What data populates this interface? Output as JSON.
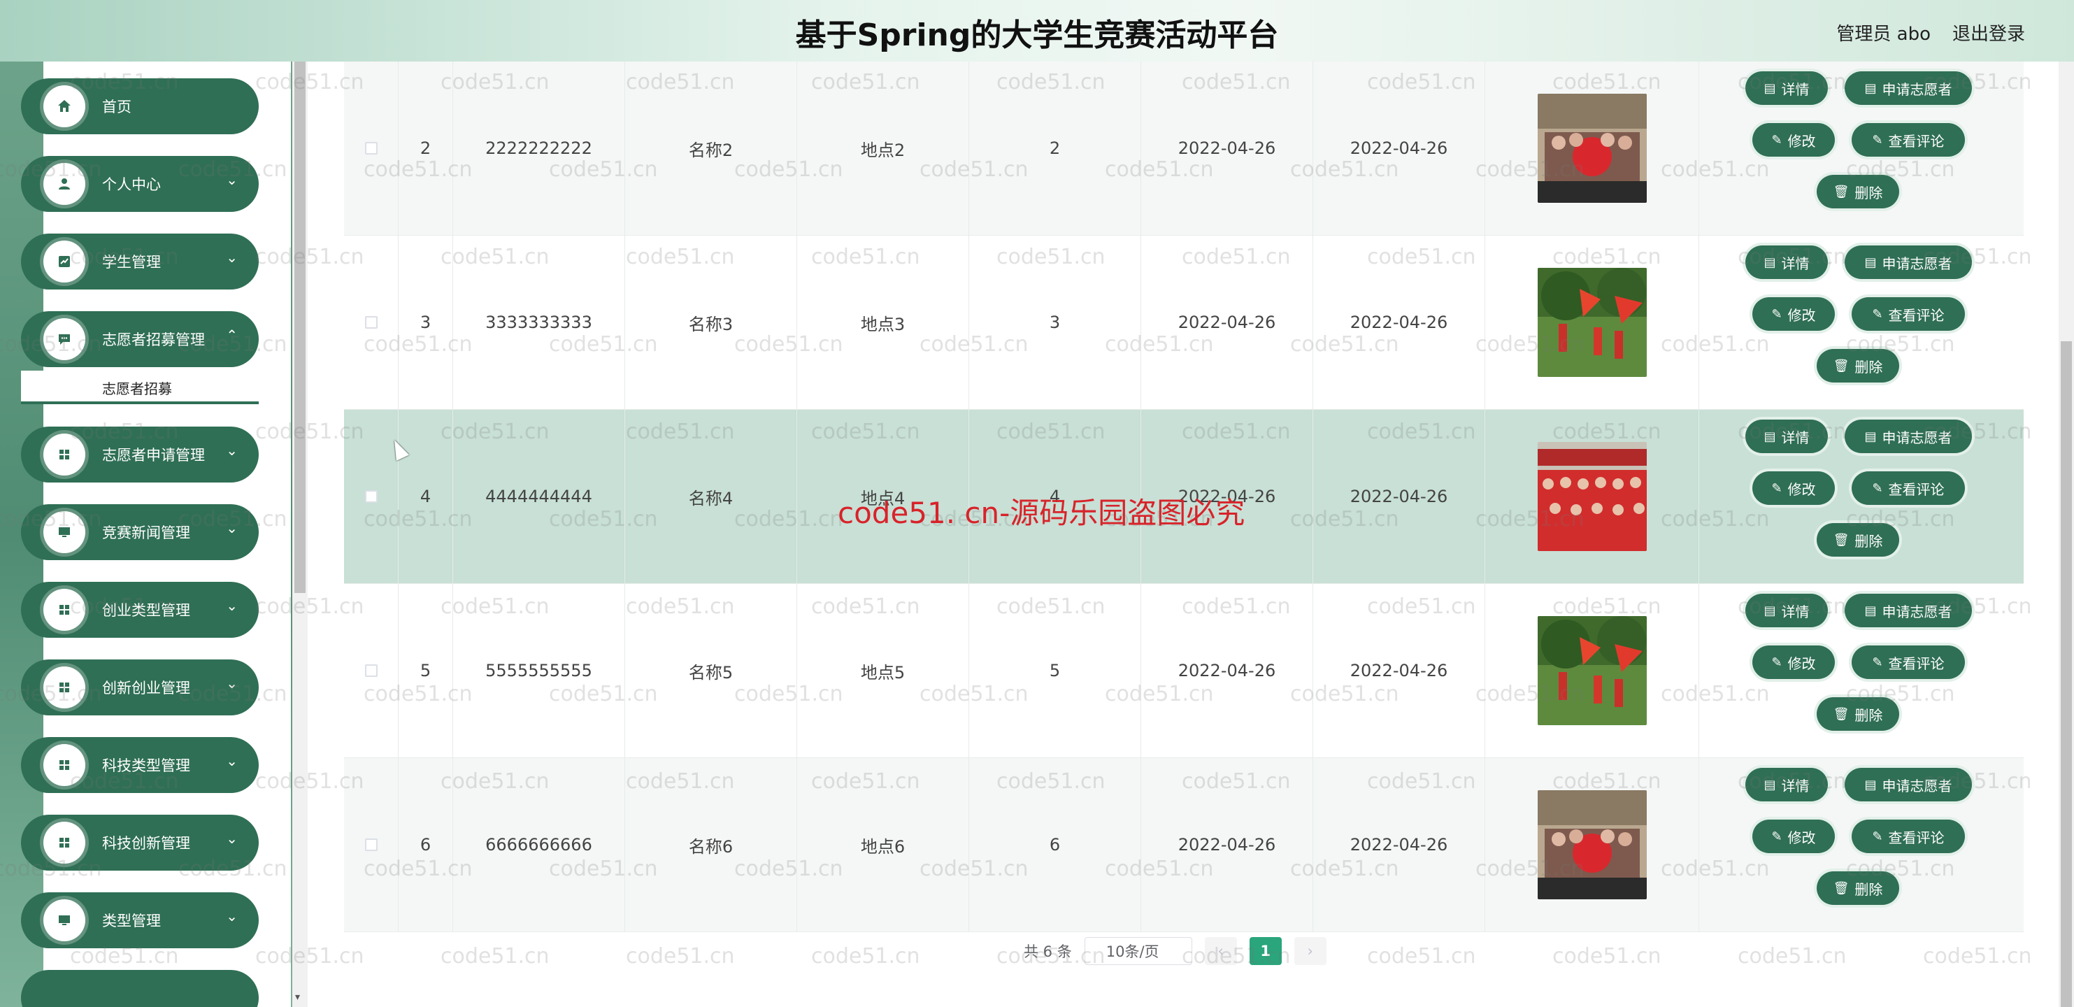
{
  "header": {
    "title": "基于Spring的大学生竞赛活动平台",
    "admin_label": "管理员 abo",
    "logout_label": "退出登录"
  },
  "sidebar": {
    "items": [
      {
        "label": "首页",
        "icon": "home-icon",
        "chevron": ""
      },
      {
        "label": "个人中心",
        "icon": "user-icon",
        "chevron": "⌄"
      },
      {
        "label": "学生管理",
        "icon": "chart-icon",
        "chevron": "⌄"
      },
      {
        "label": "志愿者招募管理",
        "icon": "message-icon",
        "chevron": "⌄"
      },
      {
        "label": "志愿者申请管理",
        "icon": "grid-icon",
        "chevron": "⌄"
      },
      {
        "label": "竞赛新闻管理",
        "icon": "monitor-icon",
        "chevron": "⌄"
      },
      {
        "label": "创业类型管理",
        "icon": "grid-icon",
        "chevron": "⌄"
      },
      {
        "label": "创新创业管理",
        "icon": "grid-icon",
        "chevron": "⌄"
      },
      {
        "label": "科技类型管理",
        "icon": "grid-icon",
        "chevron": "⌄"
      },
      {
        "label": "科技创新管理",
        "icon": "grid-icon",
        "chevron": "⌄"
      },
      {
        "label": "类型管理",
        "icon": "monitor-icon",
        "chevron": "⌄"
      }
    ],
    "submenu": {
      "label": "志愿者招募"
    }
  },
  "table": {
    "rows": [
      {
        "index": "2",
        "number": "2222222222",
        "name": "名称2",
        "place": "地点2",
        "count": "2",
        "start": "2022-04-26",
        "end": "2022-04-26",
        "image": "team-banner-photo"
      },
      {
        "index": "3",
        "number": "3333333333",
        "name": "名称3",
        "place": "地点3",
        "count": "3",
        "start": "2022-04-26",
        "end": "2022-04-26",
        "image": "flag-field-photo"
      },
      {
        "index": "4",
        "number": "4444444444",
        "name": "名称4",
        "place": "地点4",
        "count": "4",
        "start": "2022-04-26",
        "end": "2022-04-26",
        "image": "red-crowd-photo"
      },
      {
        "index": "5",
        "number": "5555555555",
        "name": "名称5",
        "place": "地点5",
        "count": "5",
        "start": "2022-04-26",
        "end": "2022-04-26",
        "image": "flag-field-photo"
      },
      {
        "index": "6",
        "number": "6666666666",
        "name": "名称6",
        "place": "地点6",
        "count": "6",
        "start": "2022-04-26",
        "end": "2022-04-26",
        "image": "team-banner-photo"
      }
    ],
    "actions": {
      "detail": "详情",
      "apply": "申请志愿者",
      "edit": "修改",
      "review": "查看评论",
      "delete": "删除"
    }
  },
  "pagination": {
    "total": "共 6 条",
    "page_size": "10条/页",
    "current_page": "1",
    "prev": "‹",
    "next": "›"
  },
  "watermark": {
    "text": "code51.cn",
    "notice": "code51. cn-源码乐园盗图必究"
  },
  "colors": {
    "primary": "#2f6f55",
    "hover_row": "#c8e0d6",
    "pager_active": "#2aa57c",
    "watermark_red": "#d8232a"
  }
}
